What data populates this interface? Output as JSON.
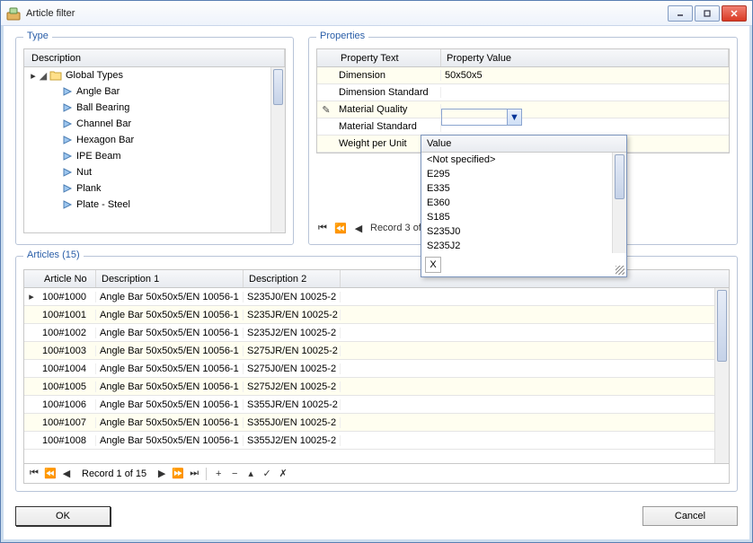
{
  "window": {
    "title": "Article filter"
  },
  "type": {
    "legend": "Type",
    "header": "Description",
    "root": "Global Types",
    "items": [
      "Angle Bar",
      "Ball Bearing",
      "Channel Bar",
      "Hexagon Bar",
      "IPE Beam",
      "Nut",
      "Plank",
      "Plate - Steel"
    ]
  },
  "props": {
    "legend": "Properties",
    "colText": "Property Text",
    "colValue": "Property Value",
    "rows": [
      {
        "text": "Dimension",
        "value": "50x50x5"
      },
      {
        "text": "Dimension Standard",
        "value": ""
      },
      {
        "text": "Material Quality",
        "value": ""
      },
      {
        "text": "Material Standard",
        "value": ""
      },
      {
        "text": "Weight per Unit",
        "value": ""
      }
    ],
    "nav": "Record 3 of 5",
    "dropdown": {
      "header": "Value",
      "options": [
        "<Not specified>",
        "E295",
        "E335",
        "E360",
        "S185",
        "S235J0",
        "S235J2"
      ],
      "clear": "X"
    }
  },
  "articles": {
    "legend": "Articles (15)",
    "cols": [
      "Article No",
      "Description 1",
      "Description 2"
    ],
    "rows": [
      {
        "no": "100#1000",
        "d1": "Angle Bar 50x50x5/EN 10056-1",
        "d2": "S235J0/EN 10025-2"
      },
      {
        "no": "100#1001",
        "d1": "Angle Bar 50x50x5/EN 10056-1",
        "d2": "S235JR/EN 10025-2"
      },
      {
        "no": "100#1002",
        "d1": "Angle Bar 50x50x5/EN 10056-1",
        "d2": "S235J2/EN 10025-2"
      },
      {
        "no": "100#1003",
        "d1": "Angle Bar 50x50x5/EN 10056-1",
        "d2": "S275JR/EN 10025-2"
      },
      {
        "no": "100#1004",
        "d1": "Angle Bar 50x50x5/EN 10056-1",
        "d2": "S275J0/EN 10025-2"
      },
      {
        "no": "100#1005",
        "d1": "Angle Bar 50x50x5/EN 10056-1",
        "d2": "S275J2/EN 10025-2"
      },
      {
        "no": "100#1006",
        "d1": "Angle Bar 50x50x5/EN 10056-1",
        "d2": "S355JR/EN 10025-2"
      },
      {
        "no": "100#1007",
        "d1": "Angle Bar 50x50x5/EN 10056-1",
        "d2": "S355J0/EN 10025-2"
      },
      {
        "no": "100#1008",
        "d1": "Angle Bar 50x50x5/EN 10056-1",
        "d2": "S355J2/EN 10025-2"
      }
    ],
    "nav": "Record 1 of 15"
  },
  "buttons": {
    "ok": "OK",
    "cancel": "Cancel"
  },
  "glyphs": {
    "first": "⏮",
    "prevpage": "⏪",
    "prev": "◀",
    "next": "▶",
    "nextpage": "⏩",
    "last": "⏭",
    "plus": "+",
    "minus": "−",
    "edit": "▴",
    "check": "✓",
    "cancel": "✗",
    "tri_open": "◢",
    "row_marker": "▸",
    "pencil": "✎",
    "dd": "▼"
  }
}
